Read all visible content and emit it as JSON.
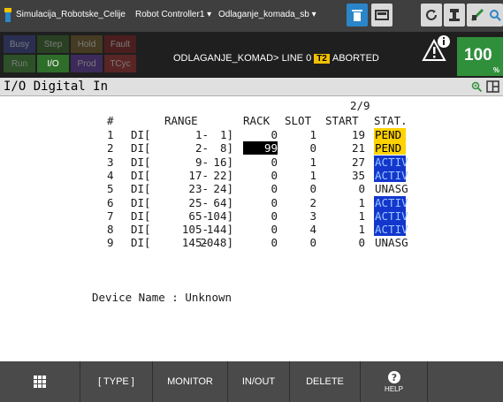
{
  "topbar": {
    "app_name": "Simulacija_Robotske_Celije",
    "controller": "Robot Controller1",
    "program": "Odlaganje_komada_sb"
  },
  "status": {
    "leds": {
      "busy": "Busy",
      "step": "Step",
      "hold": "Hold",
      "fault": "Fault",
      "run": "Run",
      "io": "I/O",
      "prod": "Prod",
      "tcyc": "TCyc"
    },
    "program_line": "ODLAGANJE_KOMAD> LINE 0",
    "mode_badge": "T2",
    "run_state": "ABORTED",
    "override_value": "100",
    "override_unit": "%"
  },
  "page": {
    "title": "I/O Digital In",
    "page_index": "2/9"
  },
  "table": {
    "headers": {
      "num": "#",
      "range": "RANGE",
      "rack": "RACK",
      "slot": "SLOT",
      "start": "START",
      "stat": "STAT."
    },
    "rows": [
      {
        "num": "1",
        "type": "DI[",
        "from": "1-",
        "to": "1]",
        "rack": "0",
        "slot": "1",
        "start": "19",
        "stat": "PEND"
      },
      {
        "num": "2",
        "type": "DI[",
        "from": "2-",
        "to": "8]",
        "rack": "99",
        "slot": "0",
        "start": "21",
        "stat": "PEND"
      },
      {
        "num": "3",
        "type": "DI[",
        "from": "9-",
        "to": "16]",
        "rack": "0",
        "slot": "1",
        "start": "27",
        "stat": "ACTIV"
      },
      {
        "num": "4",
        "type": "DI[",
        "from": "17-",
        "to": "22]",
        "rack": "0",
        "slot": "1",
        "start": "35",
        "stat": "ACTIV"
      },
      {
        "num": "5",
        "type": "DI[",
        "from": "23-",
        "to": "24]",
        "rack": "0",
        "slot": "0",
        "start": "0",
        "stat": "UNASG"
      },
      {
        "num": "6",
        "type": "DI[",
        "from": "25-",
        "to": "64]",
        "rack": "0",
        "slot": "2",
        "start": "1",
        "stat": "ACTIV"
      },
      {
        "num": "7",
        "type": "DI[",
        "from": "65-",
        "to": "104]",
        "rack": "0",
        "slot": "3",
        "start": "1",
        "stat": "ACTIV"
      },
      {
        "num": "8",
        "type": "DI[",
        "from": "105-",
        "to": "144]",
        "rack": "0",
        "slot": "4",
        "start": "1",
        "stat": "ACTIV"
      },
      {
        "num": "9",
        "type": "DI[",
        "from": "145-",
        "to": "2048]",
        "rack": "0",
        "slot": "0",
        "start": "0",
        "stat": "UNASG"
      }
    ],
    "device_name": "Device Name : Unknown"
  },
  "function_keys": {
    "type": "[ TYPE ]",
    "monitor": "MONITOR",
    "inout": "IN/OUT",
    "delete": "DELETE",
    "help": "HELP"
  },
  "colors": {
    "pend": "#ffd200",
    "activ": "#1337cc",
    "override": "#2f8f3a",
    "mode_badge": "#f0c000"
  }
}
